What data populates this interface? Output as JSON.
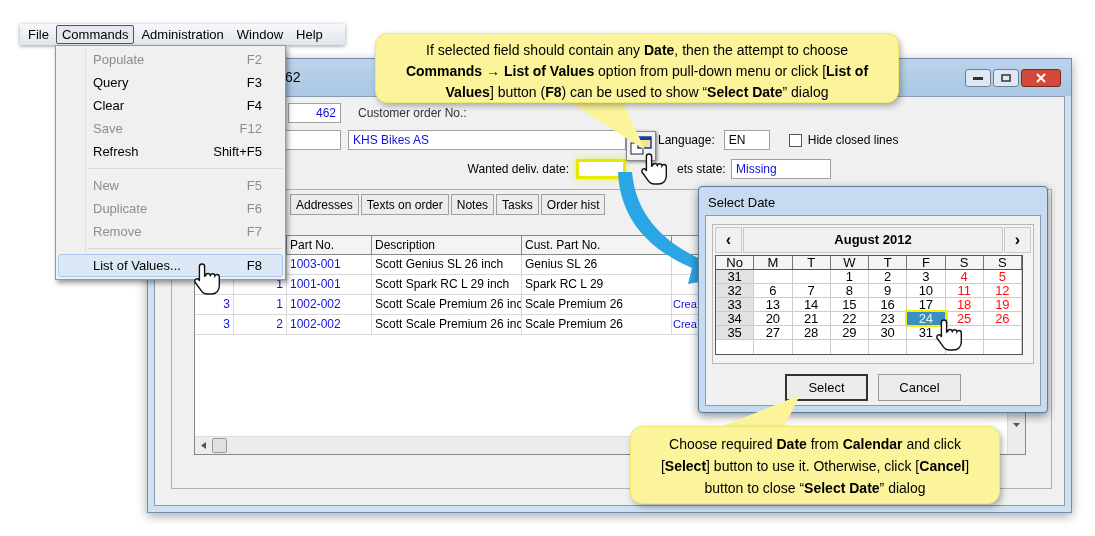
{
  "menu_bar": [
    {
      "label": "File",
      "selected": false
    },
    {
      "label": "Commands",
      "selected": true
    },
    {
      "label": "Administration",
      "selected": false
    },
    {
      "label": "Window",
      "selected": false
    },
    {
      "label": "Help",
      "selected": false
    }
  ],
  "commands_menu": [
    {
      "kind": "item",
      "label": "Populate",
      "shortcut": "F2",
      "disabled": true,
      "highlighted": false
    },
    {
      "kind": "item",
      "label": "Query",
      "shortcut": "F3",
      "disabled": false,
      "highlighted": false
    },
    {
      "kind": "item",
      "label": "Clear",
      "shortcut": "F4",
      "disabled": false,
      "highlighted": false
    },
    {
      "kind": "item",
      "label": "Save",
      "shortcut": "F12",
      "disabled": true,
      "highlighted": false
    },
    {
      "kind": "item",
      "label": "Refresh",
      "shortcut": "Shift+F5",
      "disabled": false,
      "highlighted": false
    },
    {
      "kind": "separator"
    },
    {
      "kind": "item",
      "label": "New",
      "shortcut": "F5",
      "disabled": true,
      "highlighted": false
    },
    {
      "kind": "item",
      "label": "Duplicate",
      "shortcut": "F6",
      "disabled": true,
      "highlighted": false
    },
    {
      "kind": "item",
      "label": "Remove",
      "shortcut": "F7",
      "disabled": true,
      "highlighted": false
    },
    {
      "kind": "separator"
    },
    {
      "kind": "item",
      "label": "List of Values...",
      "shortcut": "F8",
      "disabled": false,
      "highlighted": true
    }
  ],
  "window": {
    "title": "62"
  },
  "form": {
    "order_no": "462",
    "customer_order_label": "Customer order No.:",
    "customer_name": "KHS Bikes AS",
    "language_label": "Language:",
    "language": "EN",
    "hide_closed": {
      "label": "Hide closed lines",
      "checked": false
    },
    "wanted_date_label": "Wanted deliv. date:",
    "state_label": "ets state:",
    "state_value": "Missing"
  },
  "tabs": [
    {
      "label": "Addresses",
      "selected": false
    },
    {
      "label": "Texts on order",
      "selected": false
    },
    {
      "label": "Notes",
      "selected": false
    },
    {
      "label": "Tasks",
      "selected": false
    },
    {
      "label": "Order hist",
      "selected": false
    }
  ],
  "table": {
    "columns": [
      "Part No.",
      "Description",
      "Cust. Part No."
    ],
    "rows": [
      {
        "cells": [
          "1003-001",
          "Scott Genius SL 26 inch",
          "Genius SL 26"
        ]
      },
      {
        "column_2": "1",
        "cells": [
          "1001-001",
          "Scott Spark RC L 29 inch",
          "Spark RC L 29"
        ]
      },
      {
        "column_1": "3",
        "column_2": "1",
        "cells": [
          "1002-002",
          "Scott Scale Premium 26 inc",
          "Scale Premium 26"
        ],
        "column_6": "Crea"
      },
      {
        "column_1": "3",
        "column_2": "2",
        "cells": [
          "1002-002",
          "Scott Scale Premium 26 inc",
          "Scale Premium 26"
        ],
        "column_6": "Crea"
      }
    ]
  },
  "date_dialog": {
    "title": "Select Date",
    "prev": "‹",
    "next": "›",
    "month": "August 2012",
    "headers": [
      "No",
      "M",
      "T",
      "W",
      "T",
      "F",
      "S",
      "S"
    ],
    "weeks": [
      {
        "week": "31",
        "days": [
          {
            "kind": "blank"
          },
          {
            "kind": "blank"
          },
          {
            "kind": "day",
            "day": "1",
            "selected": false
          },
          {
            "kind": "day",
            "day": "2",
            "selected": false
          },
          {
            "kind": "day",
            "day": "3",
            "selected": false
          },
          {
            "kind": "day",
            "day": "4",
            "selected": false
          },
          {
            "kind": "day",
            "day": "5",
            "selected": false
          }
        ]
      },
      {
        "week": "32",
        "days": [
          {
            "kind": "day",
            "day": "6",
            "selected": false
          },
          {
            "kind": "day",
            "day": "7",
            "selected": false
          },
          {
            "kind": "day",
            "day": "8",
            "selected": false
          },
          {
            "kind": "day",
            "day": "9",
            "selected": false
          },
          {
            "kind": "day",
            "day": "10",
            "selected": false
          },
          {
            "kind": "day",
            "day": "11",
            "selected": false
          },
          {
            "kind": "day",
            "day": "12",
            "selected": false
          }
        ]
      },
      {
        "week": "33",
        "days": [
          {
            "kind": "day",
            "day": "13",
            "selected": false
          },
          {
            "kind": "day",
            "day": "14",
            "selected": false
          },
          {
            "kind": "day",
            "day": "15",
            "selected": false
          },
          {
            "kind": "day",
            "day": "16",
            "selected": false
          },
          {
            "kind": "day",
            "day": "17",
            "selected": false
          },
          {
            "kind": "day",
            "day": "18",
            "selected": false
          },
          {
            "kind": "day",
            "day": "19",
            "selected": false
          }
        ]
      },
      {
        "week": "34",
        "days": [
          {
            "kind": "day",
            "day": "20",
            "selected": false
          },
          {
            "kind": "day",
            "day": "21",
            "selected": false
          },
          {
            "kind": "day",
            "day": "22",
            "selected": false
          },
          {
            "kind": "day",
            "day": "23",
            "selected": false
          },
          {
            "kind": "day",
            "day": "24",
            "selected": true
          },
          {
            "kind": "day",
            "day": "25",
            "selected": false
          },
          {
            "kind": "day",
            "day": "26",
            "selected": false
          }
        ]
      },
      {
        "week": "35",
        "days": [
          {
            "kind": "day",
            "day": "27",
            "selected": false
          },
          {
            "kind": "day",
            "day": "28",
            "selected": false
          },
          {
            "kind": "day",
            "day": "29",
            "selected": false
          },
          {
            "kind": "day",
            "day": "30",
            "selected": false
          },
          {
            "kind": "day",
            "day": "31",
            "selected": false
          },
          {
            "kind": "blank"
          },
          {
            "kind": "blank"
          }
        ]
      }
    ],
    "buttons": [
      "Select",
      "Cancel"
    ]
  },
  "callouts": [
    "If selected field should contain any **Date**, then the attempt to choose **Commands → List of Values** option from pull-down menu or click [**List of Values**] button (**F8**) can be used to show “**Select Date**” dialog",
    "Choose required **Date** from **Calendar** and click [**Select**] button to use it. Otherwise, click [**Cancel**] button to close “**Select Date**” dialog"
  ]
}
